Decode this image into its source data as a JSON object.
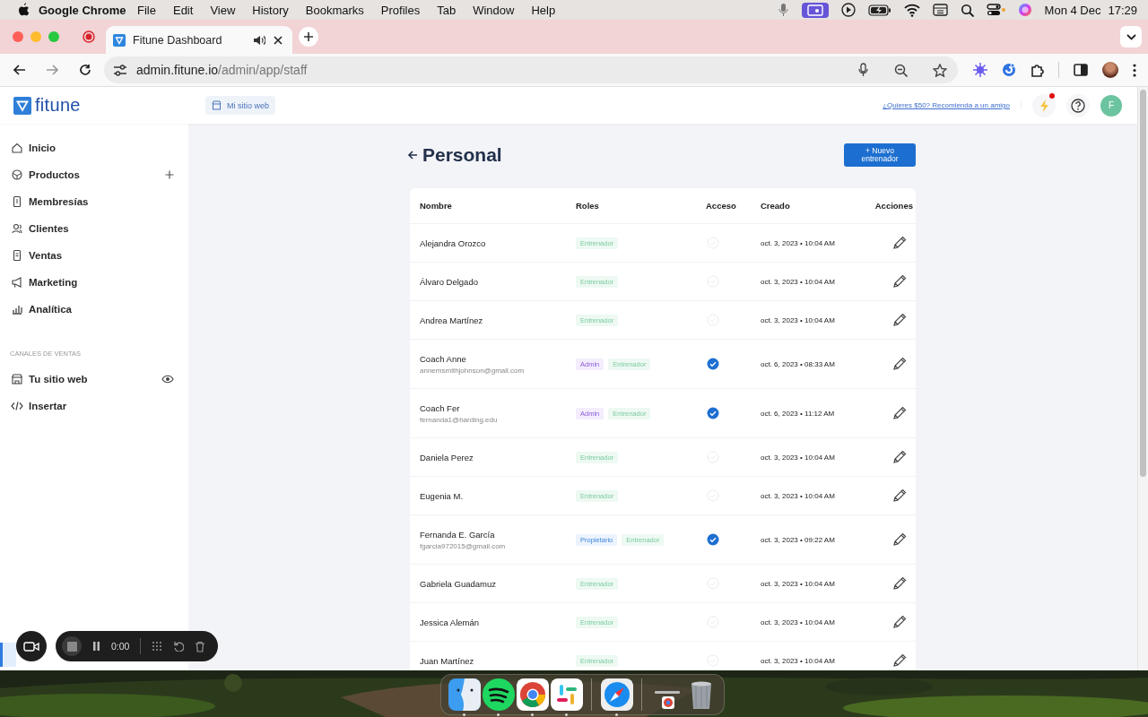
{
  "menubar": {
    "app": "Google Chrome",
    "menus": [
      "File",
      "Edit",
      "View",
      "History",
      "Bookmarks",
      "Profiles",
      "Tab",
      "Window",
      "Help"
    ],
    "date": "Mon 4 Dec",
    "time": "17:29"
  },
  "browser": {
    "tabs": [
      {
        "title": "Fitune Dashboard",
        "selected": true
      }
    ],
    "url_host": "admin.fitune.io",
    "url_path": "/admin/app/staff"
  },
  "app_header": {
    "logo": "fitune",
    "site_button": "Mi sitio web",
    "referral_link": "¿Quieres $50? Recomienda a un amigo",
    "notification_dot": true,
    "avatar": "F"
  },
  "sidebar": {
    "items": [
      {
        "label": "Inicio",
        "kind": "home"
      },
      {
        "label": "Productos",
        "kind": "box",
        "add_button": true
      },
      {
        "label": "Membresías",
        "kind": "card"
      },
      {
        "label": "Clientes",
        "kind": "users"
      },
      {
        "label": "Ventas",
        "kind": "receipt"
      },
      {
        "label": "Marketing",
        "kind": "megaphone"
      },
      {
        "label": "Analítica",
        "kind": "chart"
      }
    ],
    "section_title": "CANALES DE VENTAS",
    "channel_items": [
      {
        "label": "Tu sitio web",
        "kind": "store",
        "visibility_toggle": true
      },
      {
        "label": "Insertar",
        "kind": "code"
      }
    ]
  },
  "page": {
    "title": "Personal",
    "new_button": "+ Nuevo entrenador"
  },
  "table": {
    "columns": [
      "Nombre",
      "Roles",
      "Acceso",
      "Creado",
      "Acciones"
    ],
    "rows": [
      {
        "name": "Alejandra Orozco",
        "roles": [
          {
            "label": "Entrenador",
            "kind": "trainer"
          }
        ],
        "access": false,
        "created": "oct. 3, 2023 • 10:04 AM"
      },
      {
        "name": "Álvaro Delgado",
        "roles": [
          {
            "label": "Entrenador",
            "kind": "trainer"
          }
        ],
        "access": false,
        "created": "oct. 3, 2023 • 10:04 AM"
      },
      {
        "name": "Andrea Martínez",
        "roles": [
          {
            "label": "Entrenador",
            "kind": "trainer"
          }
        ],
        "access": false,
        "created": "oct. 3, 2023 • 10:04 AM"
      },
      {
        "name": "Coach Anne",
        "email": "annemsmithjohnson@gmail.com",
        "roles": [
          {
            "label": "Admin",
            "kind": "admin"
          },
          {
            "label": "Entrenador",
            "kind": "trainer"
          }
        ],
        "access": true,
        "created": "oct. 6, 2023 • 08:33 AM"
      },
      {
        "name": "Coach Fer",
        "email": "fernanda1@harding.edu",
        "roles": [
          {
            "label": "Admin",
            "kind": "admin"
          },
          {
            "label": "Entrenador",
            "kind": "trainer"
          }
        ],
        "access": true,
        "created": "oct. 6, 2023 • 11:12 AM"
      },
      {
        "name": "Daniela Perez",
        "roles": [
          {
            "label": "Entrenador",
            "kind": "trainer"
          }
        ],
        "access": false,
        "created": "oct. 3, 2023 • 10:04 AM"
      },
      {
        "name": "Eugenia M.",
        "roles": [
          {
            "label": "Entrenador",
            "kind": "trainer"
          }
        ],
        "access": false,
        "created": "oct. 3, 2023 • 10:04 AM"
      },
      {
        "name": "Fernanda E. García",
        "email": "fgarcia972015@gmail.com",
        "roles": [
          {
            "label": "Propietario",
            "kind": "owner"
          },
          {
            "label": "Entrenador",
            "kind": "trainer"
          }
        ],
        "access": true,
        "created": "oct. 3, 2023 • 09:22 AM"
      },
      {
        "name": "Gabriela Guadamuz",
        "roles": [
          {
            "label": "Entrenador",
            "kind": "trainer"
          }
        ],
        "access": false,
        "created": "oct. 3, 2023 • 10:04 AM"
      },
      {
        "name": "Jessica Alemán",
        "roles": [
          {
            "label": "Entrenador",
            "kind": "trainer"
          }
        ],
        "access": false,
        "created": "oct. 3, 2023 • 10:04 AM"
      },
      {
        "name": "Juan Martínez",
        "roles": [
          {
            "label": "Entrenador",
            "kind": "trainer"
          }
        ],
        "access": false,
        "created": "oct. 3, 2023 • 10:04 AM"
      }
    ]
  },
  "recorder": {
    "time": "0:00"
  },
  "dock": {
    "items": [
      {
        "kind": "finder",
        "running": true
      },
      {
        "kind": "spotify",
        "running": true
      },
      {
        "kind": "chrome",
        "running": true
      },
      {
        "kind": "slack",
        "running": true
      },
      {
        "kind": "safari",
        "running": true,
        "separator_before": true
      },
      {
        "kind": "stack",
        "running": false,
        "separator_before": true
      },
      {
        "kind": "trash",
        "running": false
      }
    ]
  }
}
